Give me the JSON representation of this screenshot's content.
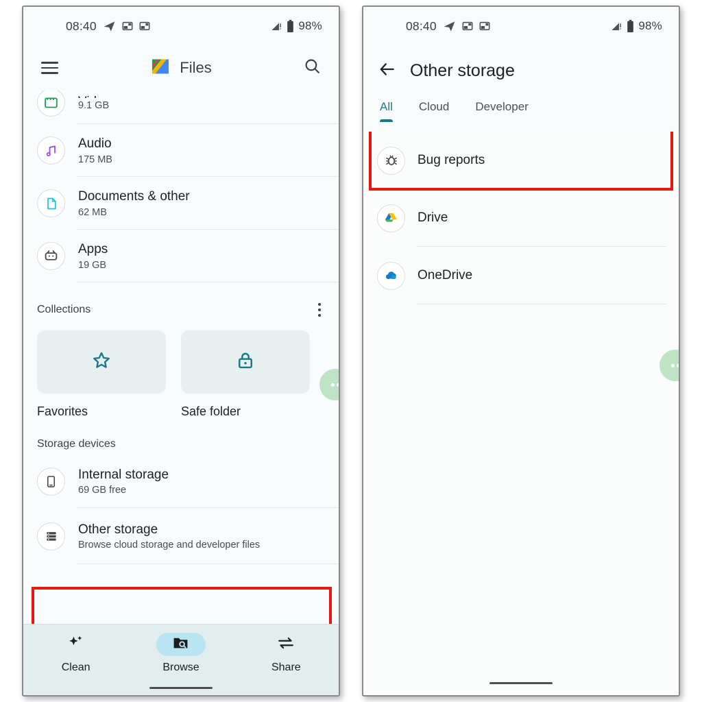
{
  "colors": {
    "highlight": "#e8170f",
    "teal_accent": "#19788c",
    "nav_bg": "#e2eeee",
    "active_pill": "#b9e4f2",
    "card_bg": "#e7f0ef"
  },
  "status_bar": {
    "time": "08:40",
    "battery_percent": "98%",
    "icons": [
      "telegram-icon",
      "notification-icon",
      "notification-icon"
    ],
    "right_icons": [
      "signal-warning-icon",
      "battery-icon"
    ]
  },
  "left_phone": {
    "app_bar": {
      "menu_icon": "hamburger-icon",
      "app_name": "Files",
      "logo": "files-by-google-logo",
      "search_icon": "search-icon"
    },
    "categories": [
      {
        "title": "Videos",
        "size": "9.1 GB",
        "icon": "video-icon",
        "clipped": true
      },
      {
        "title": "Audio",
        "size": "175 MB",
        "icon": "audio-icon"
      },
      {
        "title": "Documents & other",
        "size": "62 MB",
        "icon": "document-icon"
      },
      {
        "title": "Apps",
        "size": "19 GB",
        "icon": "apps-icon"
      }
    ],
    "collections": {
      "header": "Collections",
      "overflow_icon": "more-vert-icon",
      "items": [
        {
          "label": "Favorites",
          "icon": "star-icon"
        },
        {
          "label": "Safe folder",
          "icon": "lock-icon"
        }
      ]
    },
    "storage_devices": {
      "header": "Storage devices",
      "items": [
        {
          "title": "Internal storage",
          "subtitle": "69 GB free",
          "icon": "phone-icon",
          "highlighted": false
        },
        {
          "title": "Other storage",
          "subtitle": "Browse cloud storage and developer files",
          "icon": "storage-list-icon",
          "highlighted": true
        }
      ]
    },
    "bottom_nav": [
      {
        "label": "Clean",
        "icon": "sparkle-icon",
        "active": false
      },
      {
        "label": "Browse",
        "icon": "folder-search-icon",
        "active": true
      },
      {
        "label": "Share",
        "icon": "share-arrows-icon",
        "active": false
      }
    ]
  },
  "right_phone": {
    "back_icon": "back-arrow-icon",
    "title": "Other storage",
    "tabs": [
      {
        "label": "All",
        "active": true
      },
      {
        "label": "Cloud",
        "active": false
      },
      {
        "label": "Developer",
        "active": false
      }
    ],
    "items": [
      {
        "title": "Bug reports",
        "icon": "bug-icon",
        "highlighted": true
      },
      {
        "title": "Drive",
        "icon": "google-drive-icon",
        "highlighted": false
      },
      {
        "title": "OneDrive",
        "icon": "onedrive-icon",
        "highlighted": false
      }
    ]
  }
}
